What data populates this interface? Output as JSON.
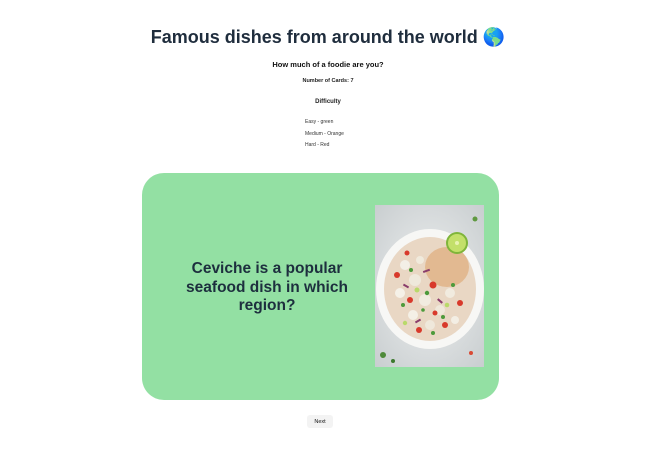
{
  "header": {
    "title": "Famous dishes from around the world 🌎",
    "subtitle": "How much of a foodie are you?",
    "card_count": "Number of Cards: 7",
    "difficulty_label": "Difficulty"
  },
  "legend": {
    "items": [
      "Easy - green",
      "Medium - Orange",
      "Hard - Red"
    ]
  },
  "card": {
    "question": "Ceviche is a popular seafood dish in which region?",
    "difficulty_color": "#93e0a3"
  },
  "controls": {
    "next_label": "Next"
  }
}
